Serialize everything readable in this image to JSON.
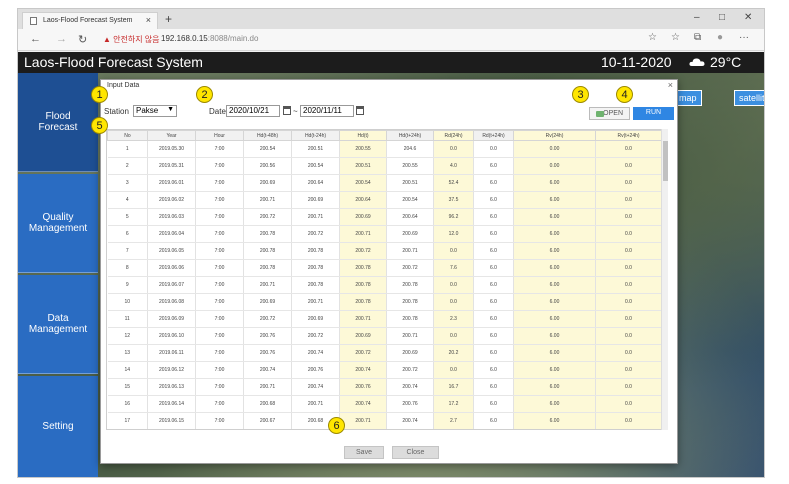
{
  "browser": {
    "tab_title": "Laos-Flood Forecast System",
    "tab_close": "×",
    "new_tab": "+",
    "min": "–",
    "max": "□",
    "close": "✕",
    "back": "←",
    "forward": "→",
    "reload": "↻",
    "security_warning": "▲ 안전하지 않음",
    "url_host": "192.168.0.15",
    "url_path": ":8088/main.do",
    "tool_star": "☆",
    "tool_favs": "☆",
    "tool_collections": "⧉",
    "tool_profile": "●",
    "tool_more": "···"
  },
  "header": {
    "title": "Laos-Flood Forecast System",
    "date": "10-11-2020",
    "weather_icon": "cloud-icon",
    "temperature": "29°C"
  },
  "sidebar": {
    "items": [
      {
        "label": "Flood Forecast"
      },
      {
        "label": "Quality Management"
      },
      {
        "label": "Data Management"
      },
      {
        "label": "Setting"
      }
    ]
  },
  "map_buttons": {
    "map": "map",
    "satellite": "satellite"
  },
  "modal": {
    "title": "Input Data",
    "close": "×",
    "station_label": "Station",
    "station_value": "Pakse",
    "date_label": "Date",
    "date_from": "2020/10/21",
    "date_sep": "~",
    "date_to": "2020/11/11",
    "open_label": "OPEN",
    "run_label": "RUN",
    "save_label": "Save",
    "close_label": "Close"
  },
  "table": {
    "columns": [
      "No",
      "Year",
      "Hour",
      "Hd(t-48h)",
      "Hd(t-24h)",
      "Hd(t)",
      "Hd(t+24h)",
      "Rd(24h)",
      "Rd(t+24h)",
      "Rv(24h)",
      "Rv(t+24h)"
    ],
    "rows": [
      [
        "1",
        "2019.05.30",
        "7:00",
        "200.54",
        "200.51",
        "200.55",
        "204.6",
        "0.0",
        "0.0",
        "0.00",
        "0.0"
      ],
      [
        "2",
        "2019.05.31",
        "7:00",
        "200.56",
        "200.54",
        "200.51",
        "200.55",
        "4.0",
        "6.0",
        "0.00",
        "0.0"
      ],
      [
        "3",
        "2019.06.01",
        "7:00",
        "200.69",
        "200.64",
        "200.54",
        "200.51",
        "52.4",
        "6.0",
        "6.00",
        "0.0"
      ],
      [
        "4",
        "2019.06.02",
        "7:00",
        "200.71",
        "200.69",
        "200.64",
        "200.54",
        "37.5",
        "6.0",
        "6.00",
        "0.0"
      ],
      [
        "5",
        "2019.06.03",
        "7:00",
        "200.72",
        "200.71",
        "200.69",
        "200.64",
        "96.2",
        "6.0",
        "6.00",
        "0.0"
      ],
      [
        "6",
        "2019.06.04",
        "7:00",
        "200.78",
        "200.72",
        "200.71",
        "200.69",
        "12.0",
        "6.0",
        "6.00",
        "0.0"
      ],
      [
        "7",
        "2019.06.05",
        "7:00",
        "200.78",
        "200.78",
        "200.72",
        "200.71",
        "0.0",
        "6.0",
        "6.00",
        "0.0"
      ],
      [
        "8",
        "2019.06.06",
        "7:00",
        "200.78",
        "200.78",
        "200.78",
        "200.72",
        "7.6",
        "6.0",
        "6.00",
        "0.0"
      ],
      [
        "9",
        "2019.06.07",
        "7:00",
        "200.71",
        "200.78",
        "200.78",
        "200.78",
        "0.0",
        "6.0",
        "6.00",
        "0.0"
      ],
      [
        "10",
        "2019.06.08",
        "7:00",
        "200.69",
        "200.71",
        "200.78",
        "200.78",
        "0.0",
        "6.0",
        "6.00",
        "0.0"
      ],
      [
        "11",
        "2019.06.09",
        "7:00",
        "200.72",
        "200.69",
        "200.71",
        "200.78",
        "2.3",
        "6.0",
        "6.00",
        "0.0"
      ],
      [
        "12",
        "2019.06.10",
        "7:00",
        "200.76",
        "200.72",
        "200.69",
        "200.71",
        "0.0",
        "6.0",
        "6.00",
        "0.0"
      ],
      [
        "13",
        "2019.06.11",
        "7:00",
        "200.76",
        "200.74",
        "200.72",
        "200.69",
        "20.2",
        "6.0",
        "6.00",
        "0.0"
      ],
      [
        "14",
        "2019.06.12",
        "7:00",
        "200.74",
        "200.76",
        "200.74",
        "200.72",
        "0.0",
        "6.0",
        "6.00",
        "0.0"
      ],
      [
        "15",
        "2019.06.13",
        "7:00",
        "200.71",
        "200.74",
        "200.76",
        "200.74",
        "16.7",
        "6.0",
        "6.00",
        "0.0"
      ],
      [
        "16",
        "2019.06.14",
        "7:00",
        "200.68",
        "200.71",
        "200.74",
        "200.76",
        "17.2",
        "6.0",
        "6.00",
        "0.0"
      ],
      [
        "17",
        "2019.06.15",
        "7:00",
        "200.67",
        "200.68",
        "200.71",
        "200.74",
        "2.7",
        "6.0",
        "6.00",
        "0.0"
      ]
    ]
  },
  "callouts": [
    "1",
    "2",
    "3",
    "4",
    "5",
    "6"
  ]
}
